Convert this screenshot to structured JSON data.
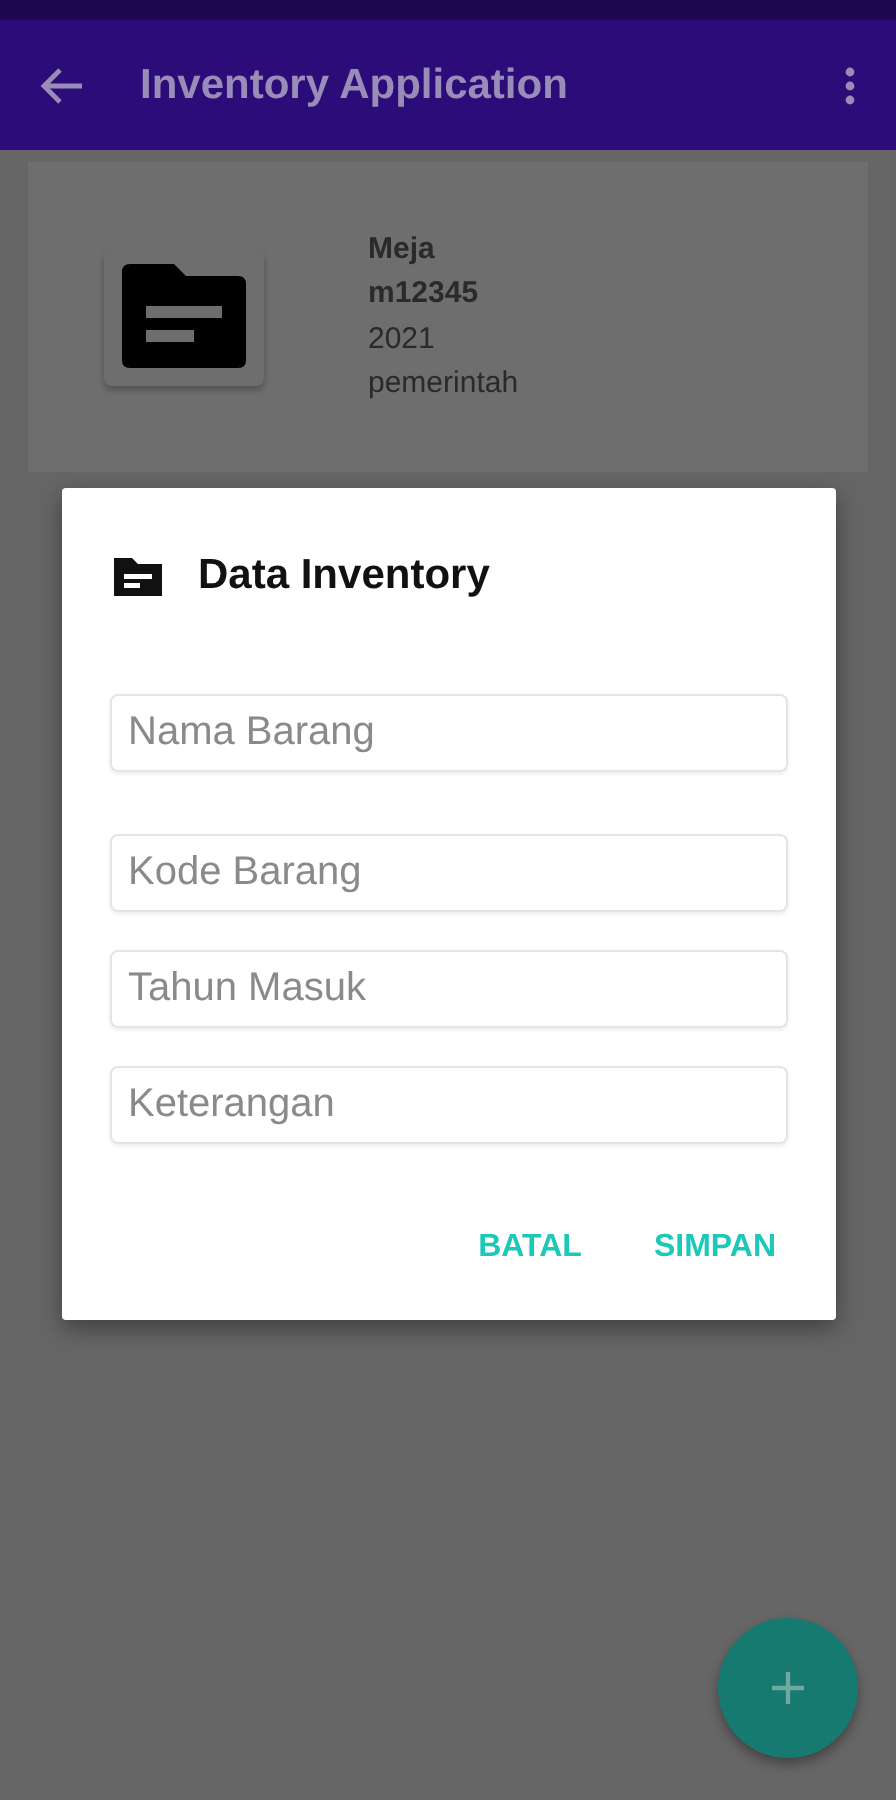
{
  "app_bar": {
    "title": "Inventory Application"
  },
  "items": [
    {
      "name": "Meja",
      "code": "m12345",
      "year": "2021",
      "note": "pemerintah"
    }
  ],
  "dialog": {
    "title": "Data Inventory",
    "fields": [
      {
        "placeholder": "Nama Barang"
      },
      {
        "placeholder": "Kode Barang"
      },
      {
        "placeholder": "Tahun Masuk"
      },
      {
        "placeholder": "Keterangan"
      }
    ],
    "buttons": [
      "BATAL",
      "SIMPAN"
    ]
  }
}
